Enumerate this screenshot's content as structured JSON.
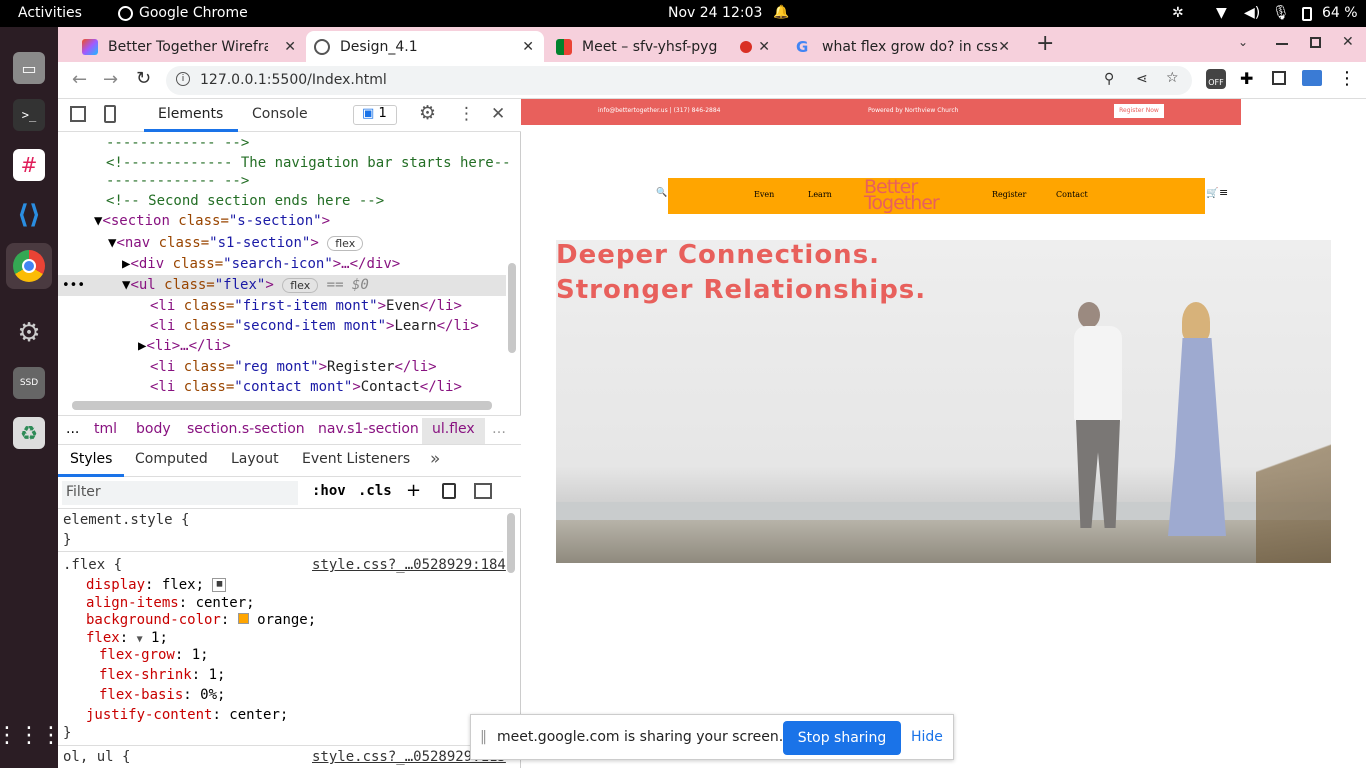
{
  "system": {
    "activities": "Activities",
    "app": "Google Chrome",
    "datetime": "Nov 24  12:03",
    "battery": "64 %"
  },
  "tabs": [
    {
      "title": "Better Together Wirefram",
      "close": "✕"
    },
    {
      "title": "Design_4.1",
      "close": "✕"
    },
    {
      "title": "Meet – sfv-yhsf-pyg",
      "close": "✕"
    },
    {
      "title": "what flex grow do? in css",
      "close": "✕"
    }
  ],
  "toolbar": {
    "url": "127.0.0.1:5500/Index.html",
    "new_tab": "+"
  },
  "devtools": {
    "tabs": {
      "elements": "Elements",
      "console": "Console",
      "issues": "1"
    },
    "dom": {
      "l1": "------------- -->",
      "l2": "<!------------- The navigation bar starts here--",
      "l3": "------------- -->",
      "l4": "<!-- Second section ends here -->",
      "l5_tag": "<section ",
      "l5_attr": "class=",
      "l5_val": "\"s-section\"",
      "l5_end": ">",
      "l6_tag": "<nav ",
      "l6_attr": "class=",
      "l6_val": "\"s1-section\"",
      "l6_end": ">",
      "l6_badge": "flex",
      "l7_tag": "<div ",
      "l7_attr": "class=",
      "l7_val": "\"search-icon\"",
      "l7_end": ">…</div>",
      "l8_tag": "<ul ",
      "l8_attr": "class=",
      "l8_val": "\"flex\"",
      "l8_end": ">",
      "l8_badge": "flex",
      "l8_sel": "== $0",
      "l9_tag": "<li ",
      "l9_attr": "class=",
      "l9_val": "\"first-item mont\"",
      "l9_text": "Even",
      "l9_close": "</li>",
      "l10_tag": "<li ",
      "l10_attr": "class=",
      "l10_val": "\"second-item mont\"",
      "l10_text": "Learn",
      "l10_close": "</li>",
      "l11": "<li>…</li>",
      "l12_tag": "<li ",
      "l12_attr": "class=",
      "l12_val": "\"reg mont\"",
      "l12_text": "Register",
      "l12_close": "</li>",
      "l13_tag": "<li ",
      "l13_attr": "class=",
      "l13_val": "\"contact mont\"",
      "l13_text": "Contact",
      "l13_close": "</li>"
    },
    "breadcrumbs": [
      "...",
      "tml",
      "body",
      "section.s-section",
      "nav.s1-section",
      "ul.flex"
    ],
    "styles_tabs": {
      "styles": "Styles",
      "computed": "Computed",
      "layout": "Layout",
      "events": "Event Listeners"
    },
    "filter": {
      "placeholder": "Filter",
      "hov": ":hov",
      "cls": ".cls"
    },
    "css": {
      "element_style": "element.style {",
      "close": "}",
      "flex_sel": ".flex {",
      "flex_src": "style.css?_…0528929:184",
      "rules": [
        {
          "p": "display",
          "v": "flex;"
        },
        {
          "p": "align-items",
          "v": "center;"
        },
        {
          "p": "background-color",
          "v": "orange;"
        },
        {
          "p": "flex",
          "v": "1;"
        },
        {
          "p": "flex-grow",
          "v": "1;"
        },
        {
          "p": "flex-shrink",
          "v": "1;"
        },
        {
          "p": "flex-basis",
          "v": "0%;"
        },
        {
          "p": "justify-content",
          "v": "center;"
        }
      ],
      "next_sel": "ol, ul {",
      "next_src": "style.css?_…0528929:115"
    }
  },
  "site": {
    "email": "info@bettertogether.us | (317) 846-2884",
    "powered": "Powered by Northview Church",
    "register_btn": "Register Now",
    "nav": [
      "Even",
      "Learn",
      "Register",
      "Contact"
    ],
    "logo_top": "Better",
    "logo_bottom": "Together",
    "headline1": "Deeper Connections.",
    "headline2": "Stronger Relationships.",
    "colors": {
      "accent": "#e8605c",
      "nav": "#ffa500"
    }
  },
  "share": {
    "text": "meet.google.com is sharing your screen.",
    "stop": "Stop sharing",
    "hide": "Hide"
  }
}
